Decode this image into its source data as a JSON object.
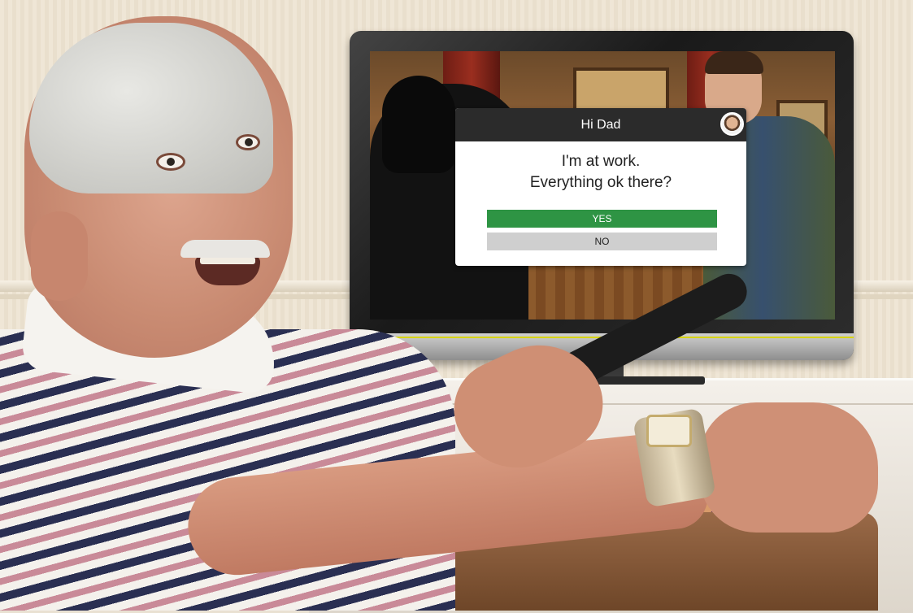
{
  "notification": {
    "title": "Hi Dad",
    "message_line1": "I'm at work.",
    "message_line2": "Everything ok there?",
    "yes_label": "YES",
    "no_label": "NO"
  },
  "colors": {
    "header": "#2b2b2b",
    "yes_button": "#2e9444",
    "no_button": "#cfcfcf",
    "tv_indicator": "#d8d400"
  },
  "icons": {
    "sender_avatar": "avatar-icon"
  }
}
